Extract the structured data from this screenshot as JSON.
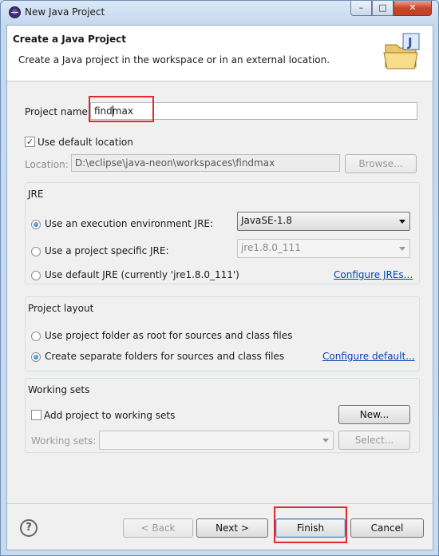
{
  "window": {
    "title": "New Java Project"
  },
  "header": {
    "title": "Create a Java Project",
    "description": "Create a Java project in the workspace or in an external location."
  },
  "project": {
    "name_label": "Project name:",
    "name_value": "findmax"
  },
  "location": {
    "use_default_label": "Use default location",
    "use_default_checked": true,
    "location_label": "Location:",
    "location_value": "D:\\eclipse\\java-neon\\workspaces\\findmax",
    "browse_label": "Browse..."
  },
  "jre": {
    "group_title": "JRE",
    "option_env_label": "Use an execution environment JRE:",
    "option_env_value": "JavaSE-1.8",
    "option_specific_label": "Use a project specific JRE:",
    "option_specific_value": "jre1.8.0_111",
    "option_default_label": "Use default JRE (currently 'jre1.8.0_111')",
    "configure_link": "Configure JREs...",
    "selected": "env"
  },
  "layout": {
    "group_title": "Project layout",
    "option_root_label": "Use project folder as root for sources and class files",
    "option_separate_label": "Create separate folders for sources and class files",
    "configure_link": "Configure default...",
    "selected": "separate"
  },
  "working_sets": {
    "group_title": "Working sets",
    "add_label": "Add project to working sets",
    "add_checked": false,
    "new_button": "New...",
    "sets_label": "Working sets:",
    "select_button": "Select..."
  },
  "buttons": {
    "help": "?",
    "back": "< Back",
    "next": "Next >",
    "finish": "Finish",
    "cancel": "Cancel"
  },
  "colors": {
    "highlight_box": "#e0282e",
    "link": "#0645ad"
  }
}
